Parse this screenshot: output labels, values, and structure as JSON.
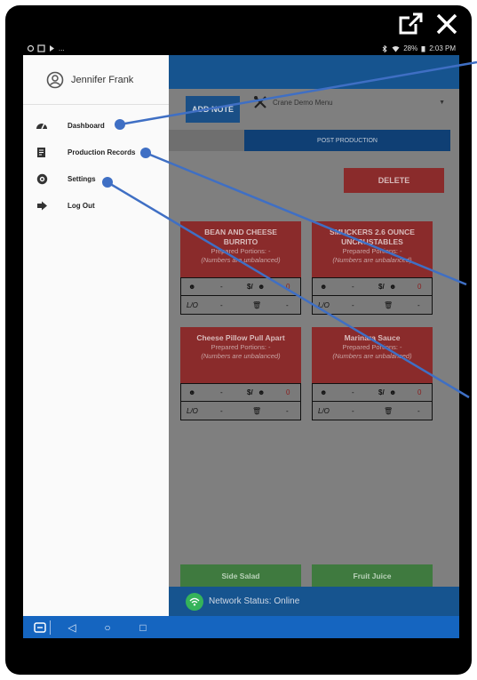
{
  "window": {
    "controls": [
      "external-link-icon",
      "close-icon"
    ]
  },
  "statusbar": {
    "left_icons": [
      "sync-icon",
      "box-icon",
      "play-icon"
    ],
    "ellipsis": "...",
    "battery": "28%",
    "time": "2:03 PM"
  },
  "drawer": {
    "user_name": "Jennifer Frank",
    "items": [
      {
        "label": "Dashboard",
        "icon": "dashboard-icon"
      },
      {
        "label": "Production Records",
        "icon": "records-icon"
      },
      {
        "label": "Settings",
        "icon": "gear-icon"
      },
      {
        "label": "Log Out",
        "icon": "logout-icon"
      }
    ]
  },
  "toolbar": {
    "add_note": "ADD NOTE",
    "menu_name": "Crane Demo Menu"
  },
  "tabs": {
    "post": "POST PRODUCTION"
  },
  "delete_label": "DELETE",
  "cards": [
    {
      "name_line1": "BEAN AND CHEESE",
      "name_line2": "BURRITO",
      "portions": "Prepared Portions: -",
      "note": "(Numbers are unbalanced)",
      "left1": "-",
      "right1": "0",
      "left2": "-",
      "right2": "-",
      "lo": "L/O",
      "cost": "$/"
    },
    {
      "name_line1": "SMUCKERS 2.6 OUNCE",
      "name_line2": "UNCRUSTABLES",
      "portions": "Prepared Portions: -",
      "note": "(Numbers are unbalanced)",
      "left1": "-",
      "right1": "0",
      "left2": "-",
      "right2": "-",
      "lo": "L/O",
      "cost": "$/"
    },
    {
      "name_line1": "Cheese Pillow Pull Apart",
      "name_line2": "",
      "portions": "Prepared Portions: -",
      "note": "(Numbers are unbalanced)",
      "left1": "-",
      "right1": "0",
      "left2": "-",
      "right2": "-",
      "lo": "L/O",
      "cost": "$/"
    },
    {
      "name_line1": "Marinara Sauce",
      "name_line2": "",
      "portions": "Prepared Portions: -",
      "note": "(Numbers are unbalanced)",
      "left1": "-",
      "right1": "0",
      "left2": "-",
      "right2": "-",
      "lo": "L/O",
      "cost": "$/"
    }
  ],
  "green_cards": [
    "Side Salad",
    "Fruit Juice"
  ],
  "network_status": "Network Status: Online",
  "navbar": {
    "icons": [
      "app-switch-icon",
      "back-icon",
      "home-icon",
      "recents-icon"
    ]
  },
  "colors": {
    "appbar": "#16548f",
    "card_red": "#8a2b2b",
    "annotation": "#3f6fc4"
  }
}
